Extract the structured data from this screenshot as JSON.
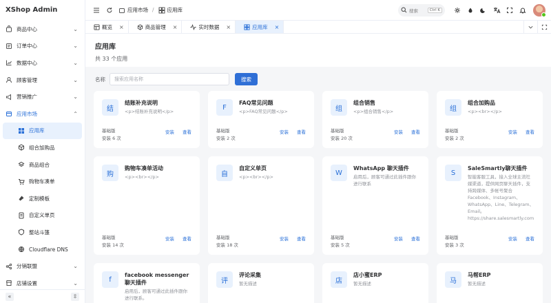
{
  "sidebar": {
    "brand": "XShop Admin",
    "menu": [
      {
        "label": "商品中心",
        "icon": "bag-icon"
      },
      {
        "label": "订单中心",
        "icon": "order-icon"
      },
      {
        "label": "数据中心",
        "icon": "chart-icon"
      },
      {
        "label": "顾客管理",
        "icon": "user-icon"
      },
      {
        "label": "营销推广",
        "icon": "promo-icon"
      },
      {
        "label": "应用市场",
        "icon": "apps-icon"
      }
    ],
    "submenu": [
      {
        "label": "应用库",
        "icon": "app-library-icon"
      },
      {
        "label": "组合加购品",
        "icon": "cube-icon"
      },
      {
        "label": "商品组合",
        "icon": "layers-icon"
      },
      {
        "label": "购物车凑单",
        "icon": "cart-icon"
      },
      {
        "label": "定制模板",
        "icon": "template-icon"
      },
      {
        "label": "自定义单页",
        "icon": "page-icon"
      },
      {
        "label": "整站斗篷",
        "icon": "cloak-icon"
      },
      {
        "label": "Cloudflare DNS",
        "icon": "dns-icon"
      }
    ],
    "menu_after": [
      {
        "label": "分销联盟",
        "icon": "share-icon"
      },
      {
        "label": "店铺设置",
        "icon": "store-icon"
      }
    ]
  },
  "header": {
    "breadcrumb": [
      "应用市场",
      "应用库"
    ],
    "search_placeholder": "搜索",
    "search_shortcut": "Ctrl K"
  },
  "tabs": [
    {
      "label": "概览",
      "icon": "overview-icon",
      "active": false
    },
    {
      "label": "商品管理",
      "icon": "cube-icon",
      "active": false
    },
    {
      "label": "实时数据",
      "icon": "pulse-icon",
      "active": false
    },
    {
      "label": "应用库",
      "icon": "app-library-icon",
      "active": true
    }
  ],
  "page": {
    "title": "应用库",
    "subtitle": "共 33 个应用"
  },
  "filter": {
    "label": "名称",
    "placeholder": "搜索应用名称",
    "button": "搜索"
  },
  "card_actions": {
    "install": "安装",
    "view": "查看"
  },
  "cards": [
    {
      "icon": "结",
      "name": "结账补充说明",
      "desc": "<p>结账补充说明</p>",
      "tier": "基础版",
      "installs": "安装 6 次"
    },
    {
      "icon": "F",
      "name": "FAQ常见问题",
      "desc": "<p>FAQ常见问题</p>",
      "tier": "基础版",
      "installs": "安装 2 次"
    },
    {
      "icon": "组",
      "name": "组合销售",
      "desc": "<p>组合销售</p>",
      "tier": "基础版",
      "installs": "安装 20 次"
    },
    {
      "icon": "组",
      "name": "组合加购品",
      "desc": "<p><br></p>",
      "tier": "基础版",
      "installs": "安装 2 次"
    },
    {
      "icon": "购",
      "name": "购物车凑单活动",
      "desc": "<p><br></p>",
      "tier": "基础版",
      "installs": "安装 14 次"
    },
    {
      "icon": "自",
      "name": "自定义单页",
      "desc": "<p><br></p>",
      "tier": "基础版",
      "installs": "安装 18 次"
    },
    {
      "icon": "W",
      "name": "WhatsApp 聊天插件",
      "desc": "启用后，顾客可通过此插件跟你进行联系",
      "tier": "基础版",
      "installs": "安装 5 次"
    },
    {
      "icon": "S",
      "name": "SaleSmartly聊天插件",
      "desc": "智能客服工具，接入全球主流社媒渠道，提供网页聊天插件，支持跨媒体、多帐号聚合Facebook、Instagram、WhatsApp、Line、Telegram、Email。https://share.salesmartly.com",
      "tier": "基础版",
      "installs": "安装 3 次"
    },
    {
      "icon": "f",
      "name": "facebook messenger 聊天插件",
      "desc": "启用后，顾客可通过此插件跟你进行联系。",
      "tier": "",
      "installs": ""
    },
    {
      "icon": "评",
      "name": "评论采集",
      "desc": "暂无描述",
      "tier": "",
      "installs": ""
    },
    {
      "icon": "店",
      "name": "店小蜜ERP",
      "desc": "暂无描述",
      "tier": "",
      "installs": ""
    },
    {
      "icon": "马",
      "name": "马帮ERP",
      "desc": "暂无描述",
      "tier": "",
      "installs": ""
    }
  ],
  "colors": {
    "primary": "#2f6fd6",
    "active_bg": "#e8f1fd",
    "page_bg": "#f5f6f8"
  }
}
